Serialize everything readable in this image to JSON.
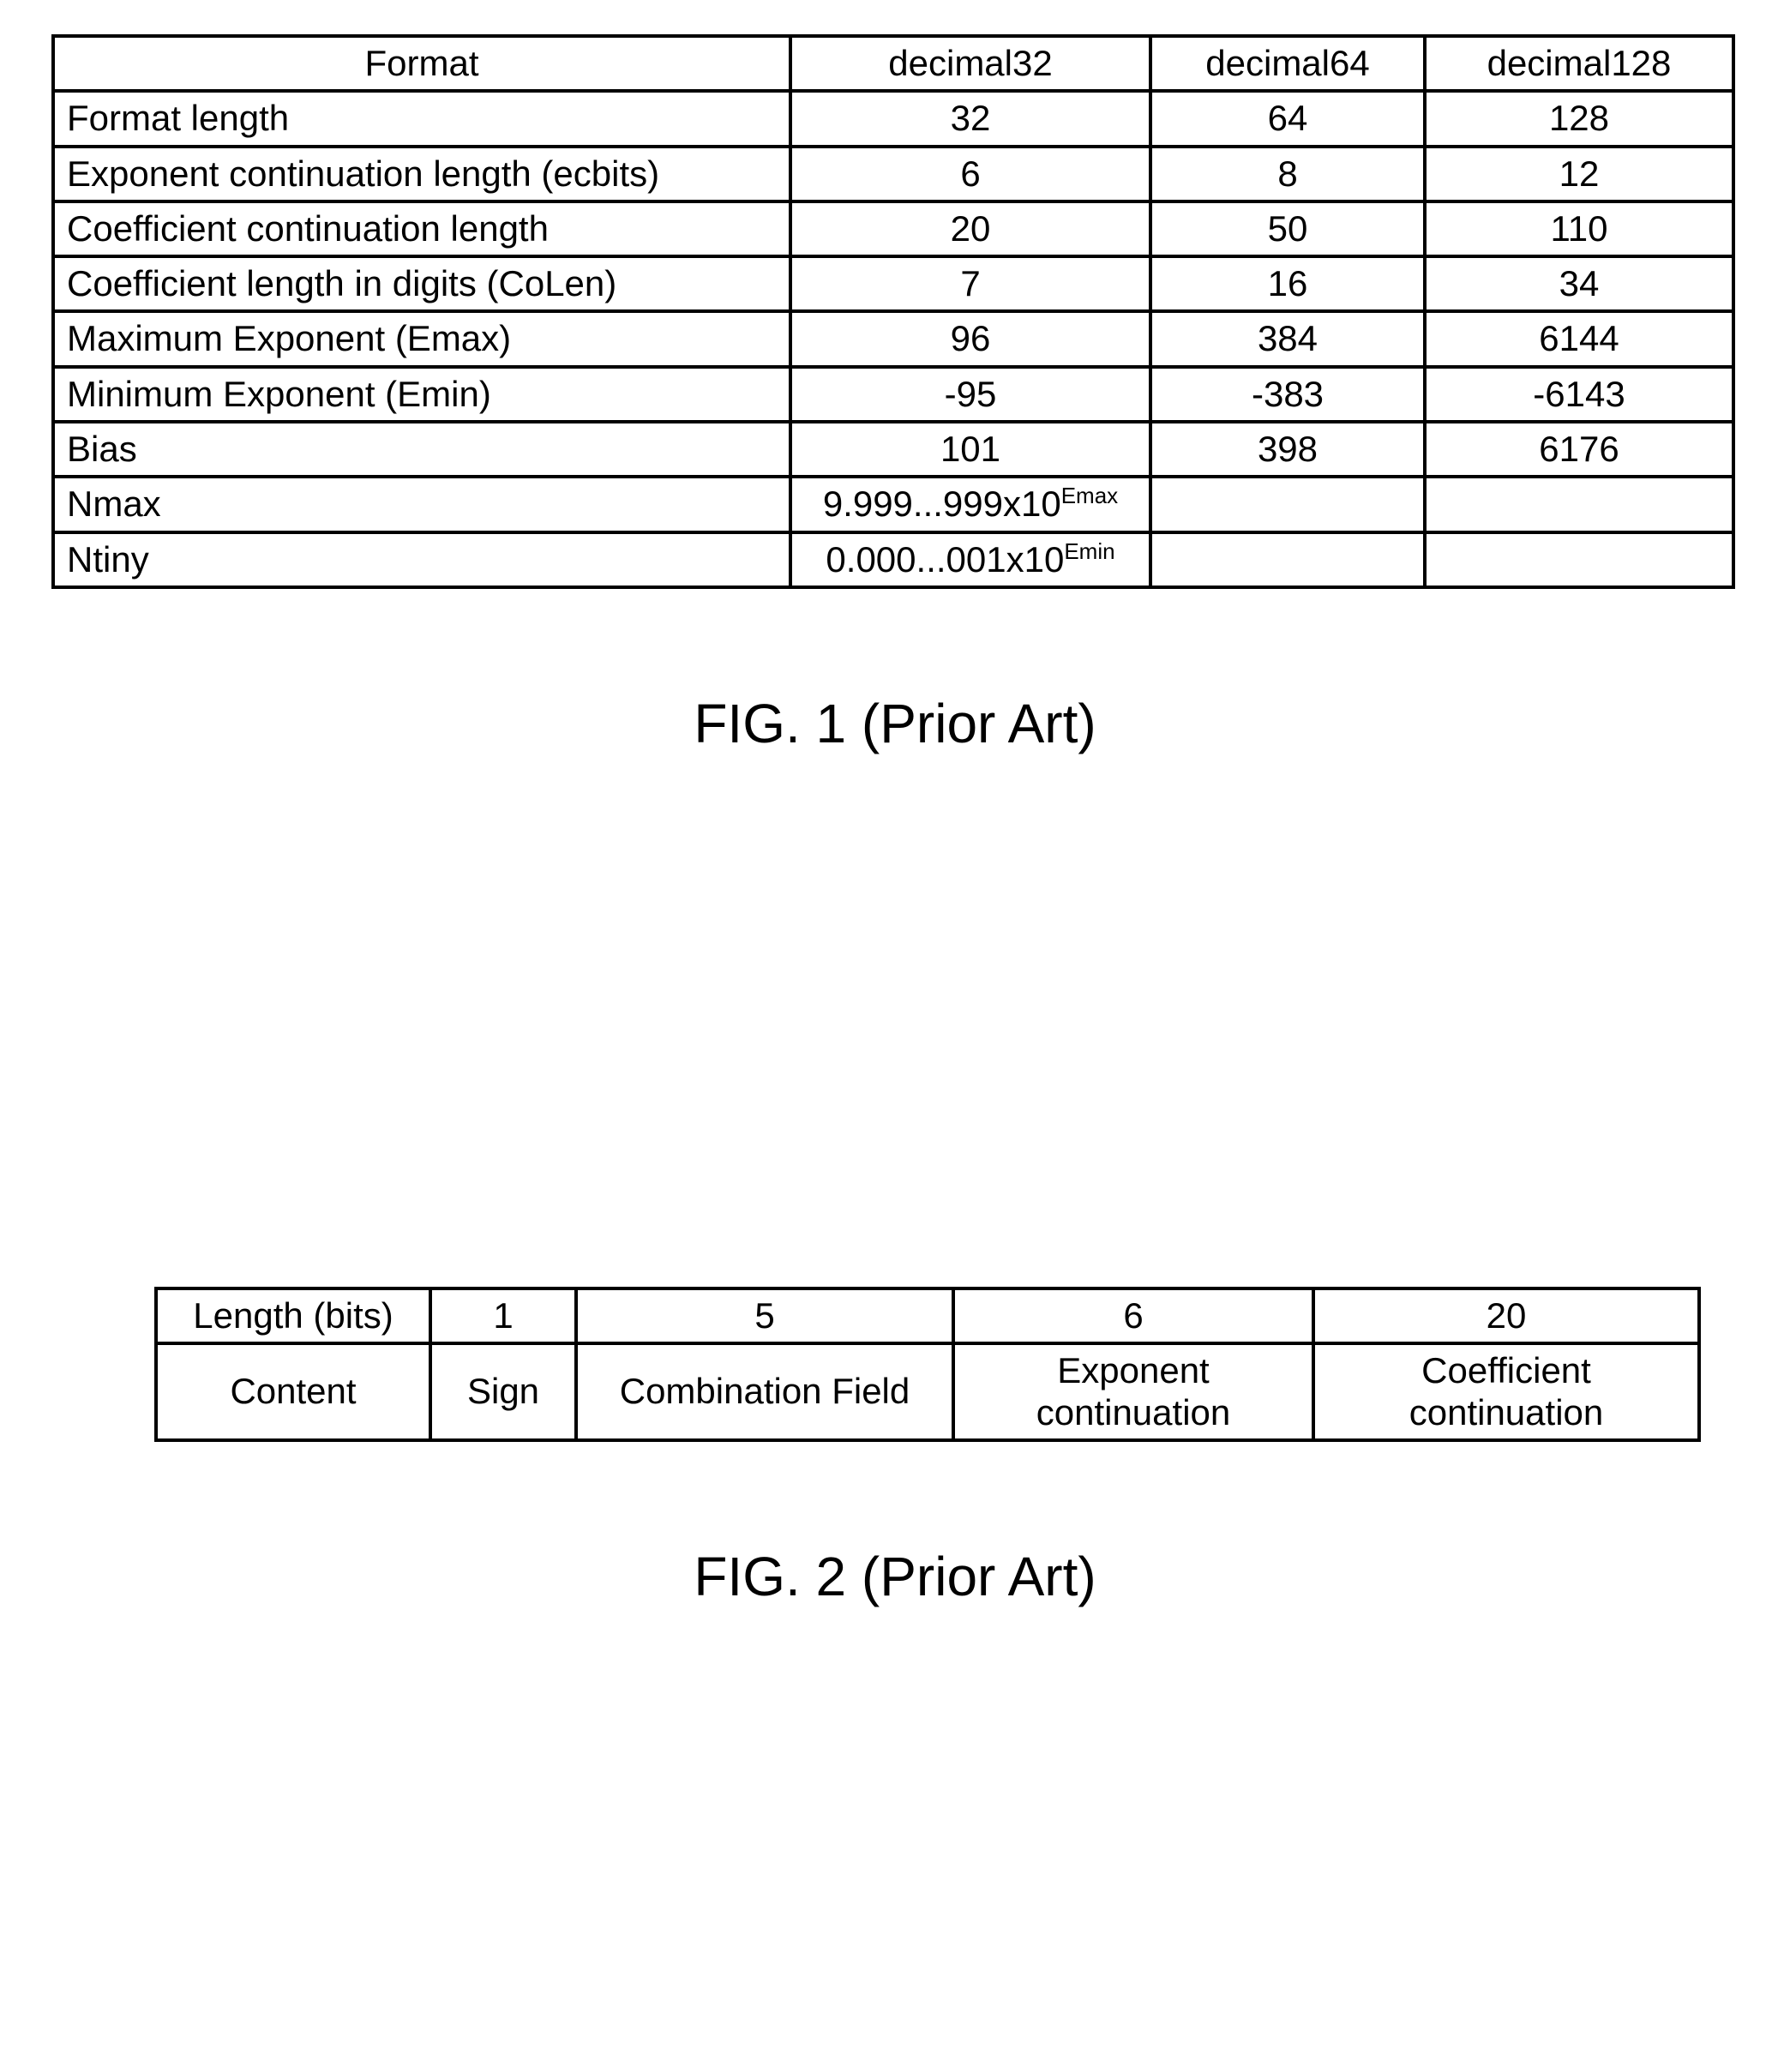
{
  "fig1": {
    "caption": "FIG. 1 (Prior Art)",
    "headers": [
      "Format",
      "decimal32",
      "decimal64",
      "decimal128"
    ],
    "rows": [
      {
        "label": "Format length",
        "v": [
          "32",
          "64",
          "128"
        ]
      },
      {
        "label": "Exponent continuation length (ecbits)",
        "v": [
          "6",
          "8",
          "12"
        ]
      },
      {
        "label": "Coefficient continuation length",
        "v": [
          "20",
          "50",
          "110"
        ]
      },
      {
        "label": "Coefficient length in digits (CoLen)",
        "v": [
          "7",
          "16",
          "34"
        ]
      },
      {
        "label": "Maximum Exponent (Emax)",
        "v": [
          "96",
          "384",
          "6144"
        ]
      },
      {
        "label": "Minimum Exponent (Emin)",
        "v": [
          "-95",
          "-383",
          "-6143"
        ]
      },
      {
        "label": "Bias",
        "v": [
          "101",
          "398",
          "6176"
        ]
      }
    ],
    "nmax_label": "Nmax",
    "nmax_base": "9.999...999x10",
    "nmax_sup": "Emax",
    "ntiny_label": "Ntiny",
    "ntiny_base": "0.000...001x10",
    "ntiny_sup": "Emin"
  },
  "fig2": {
    "caption": "FIG. 2 (Prior Art)",
    "row1": [
      "Length (bits)",
      "1",
      "5",
      "6",
      "20"
    ],
    "row2": [
      "Content",
      "Sign",
      "Combination Field",
      "Exponent continuation",
      "Coefficient continuation"
    ]
  },
  "chart_data": [
    {
      "type": "table",
      "title": "FIG. 1 (Prior Art)",
      "columns": [
        "Format",
        "decimal32",
        "decimal64",
        "decimal128"
      ],
      "rows": [
        [
          "Format length",
          "32",
          "64",
          "128"
        ],
        [
          "Exponent continuation length (ecbits)",
          "6",
          "8",
          "12"
        ],
        [
          "Coefficient continuation length",
          "20",
          "50",
          "110"
        ],
        [
          "Coefficient length in digits (CoLen)",
          "7",
          "16",
          "34"
        ],
        [
          "Maximum Exponent (Emax)",
          "96",
          "384",
          "6144"
        ],
        [
          "Minimum Exponent (Emin)",
          "-95",
          "-383",
          "-6143"
        ],
        [
          "Bias",
          "101",
          "398",
          "6176"
        ],
        [
          "Nmax",
          "9.999...999x10^Emax",
          "",
          ""
        ],
        [
          "Ntiny",
          "0.000...001x10^Emin",
          "",
          ""
        ]
      ]
    },
    {
      "type": "table",
      "title": "FIG. 2 (Prior Art)",
      "columns": [
        "Length (bits)",
        "1",
        "5",
        "6",
        "20"
      ],
      "rows": [
        [
          "Content",
          "Sign",
          "Combination Field",
          "Exponent continuation",
          "Coefficient continuation"
        ]
      ]
    }
  ]
}
